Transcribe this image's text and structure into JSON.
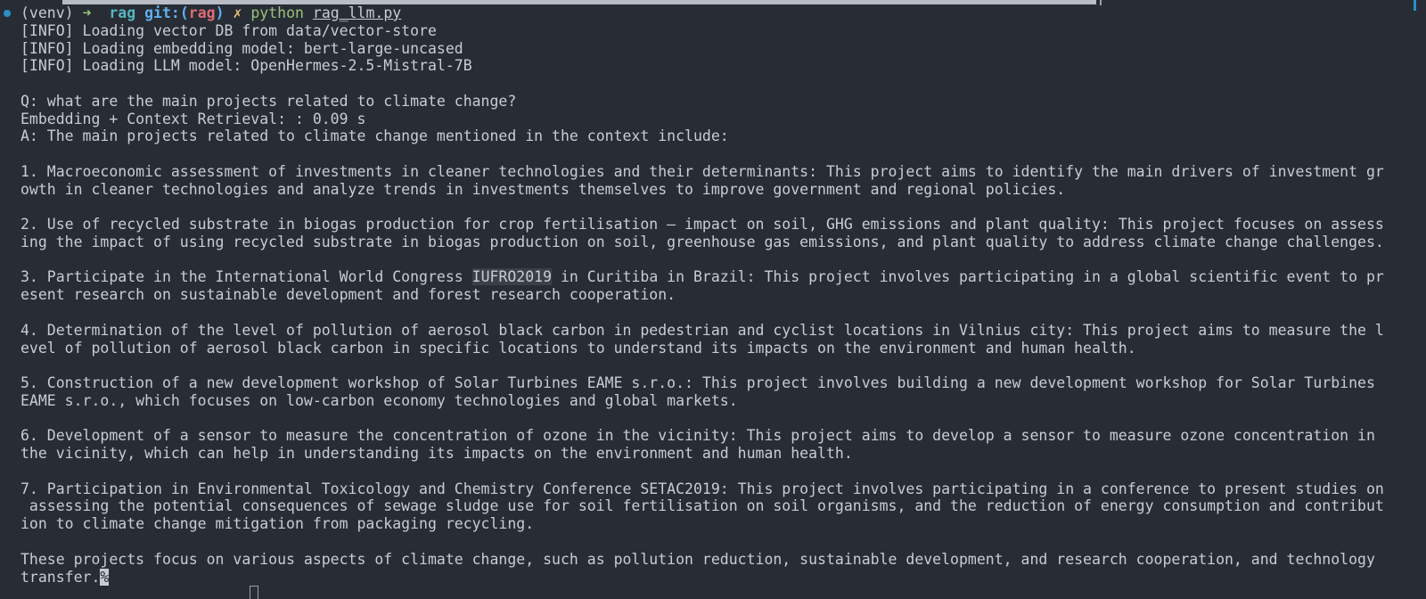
{
  "prompt": {
    "venv": "(venv)",
    "arrow": "➜",
    "dir": "rag",
    "git_label": "git:(",
    "branch": "rag",
    "git_close": ")",
    "dirty": "✗",
    "command": "python",
    "argument": "rag_llm.py"
  },
  "log": [
    "[INFO] Loading vector DB from data/vector-store",
    "[INFO] Loading embedding model: bert-large-uncased",
    "[INFO] Loading LLM model: OpenHermes-2.5-Mistral-7B"
  ],
  "question": "Q: what are the main projects related to climate change?",
  "timing": "Embedding + Context Retrieval: : 0.09 s",
  "answer_intro": "A: The main projects related to climate change mentioned in the context include:",
  "items": [
    [
      "1. Macroeconomic assessment of investments in cleaner technologies and their determinants: This project aims to identify the main drivers of investment gr",
      "owth in cleaner technologies and analyze trends in investments themselves to improve government and regional policies."
    ],
    [
      "2. Use of recycled substrate in biogas production for crop fertilisation – impact on soil, GHG emissions and plant quality: This project focuses on assess",
      "ing the impact of using recycled substrate in biogas production on soil, greenhouse gas emissions, and plant quality to address climate change challenges."
    ],
    [
      "3. Participate in the International World Congress ",
      "IUFRO2019",
      " in Curitiba in Brazil: This project involves participating in a global scientific event to pr",
      "esent research on sustainable development and forest research cooperation."
    ],
    [
      "4. Determination of the level of pollution of aerosol black carbon in pedestrian and cyclist locations in Vilnius city: This project aims to measure the l",
      "evel of pollution of aerosol black carbon in specific locations to understand its impacts on the environment and human health."
    ],
    [
      "5. Construction of a new development workshop of Solar Turbines EAME s.r.o.: This project involves building a new development workshop for Solar Turbines",
      "EAME s.r.o., which focuses on low-carbon economy technologies and global markets."
    ],
    [
      "6. Development of a sensor to measure the concentration of ozone in the vicinity: This project aims to develop a sensor to measure ozone concentration in",
      "the vicinity, which can help in understanding its impacts on the environment and human health."
    ],
    [
      "7. Participation in Environmental Toxicology and Chemistry Conference SETAC2019: This project involves participating in a conference to present studies on",
      " assessing the potential consequences of sewage sludge use for soil fertilisation on soil organisms, and the reduction of energy consumption and contribut",
      "ion to climate change mitigation from packaging recycling."
    ]
  ],
  "conclusion": [
    "These projects focus on various aspects of climate change, such as pollution reduction, sustainable development, and research cooperation, and technology",
    "transfer."
  ],
  "end_marker": "%"
}
